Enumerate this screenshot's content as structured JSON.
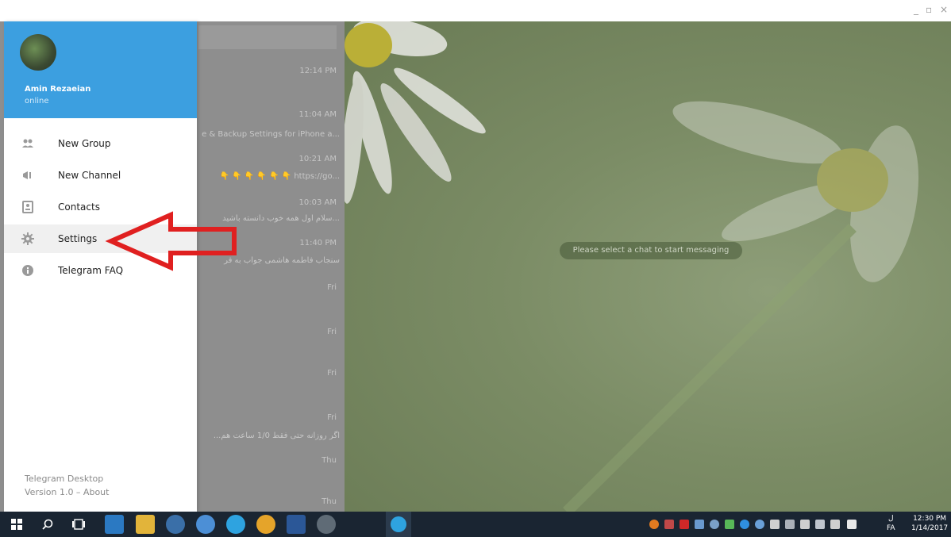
{
  "window": {
    "controls": [
      "_",
      "▫",
      "×"
    ]
  },
  "profile": {
    "name": "Amin Rezaeian",
    "status": "online"
  },
  "menu": [
    {
      "label": "New Group",
      "icon": "group-icon"
    },
    {
      "label": "New Channel",
      "icon": "channel-icon"
    },
    {
      "label": "Contacts",
      "icon": "contacts-icon"
    },
    {
      "label": "Settings",
      "icon": "gear-icon",
      "active": true
    },
    {
      "label": "Telegram FAQ",
      "icon": "info-icon"
    }
  ],
  "footer": {
    "app": "Telegram Desktop",
    "version": "Version 1.0 – About"
  },
  "chat_list": {
    "times": [
      "12:14 PM",
      "11:04 AM",
      "10:21 AM",
      "10:03 AM",
      "11:40 PM",
      "Fri",
      "Fri",
      "Fri",
      "Fri",
      "Thu",
      "Thu"
    ],
    "snippets": [
      "e & Backup Settings for iPhone a...",
      "👇 👇 👇 👇 👇 👇 https://go...",
      "سلام اول همه خوب دانسته باشید...",
      "سنجاب فاطمه هاشمی جواب به فر",
      "...اگر روزانه حتی فقط 1/0 ساعت هم"
    ]
  },
  "empty_state": "Please select a chat to start messaging",
  "taskbar": {
    "time": "12:30 PM",
    "date": "1/14/2017",
    "lang": "FA",
    "lang_top": "ل"
  },
  "colors": {
    "accent": "#3c9fe0",
    "arrow": "#e02020",
    "taskbar": "#1a2532"
  }
}
